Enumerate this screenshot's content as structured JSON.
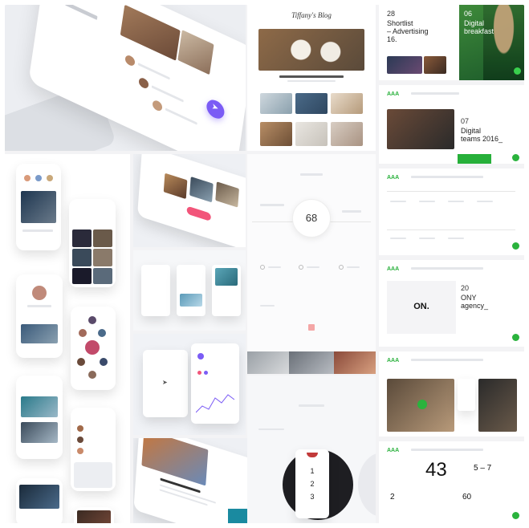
{
  "blog": {
    "title": "Tiffany's Blog"
  },
  "dashboard": {
    "gauge_value": "68"
  },
  "agency": {
    "c1_day": "28",
    "c1_title_l1": "Shortlist",
    "c1_title_l2": "– Advertising",
    "c1_title_l3": "16.",
    "c2_day": "06",
    "c2_title_l1": "Digital",
    "c2_title_l2": "breakfast",
    "c3_day": "07",
    "c3_title_l1": "Digital",
    "c3_title_l2": "teams 2016_",
    "logo_text": "ON.",
    "c4_day": "20",
    "c4_title_l1": "ONY",
    "c4_title_l2": "agency_",
    "stat_big": "43",
    "stat_range": "5 – 7",
    "stat_small_1": "2",
    "stat_small_2": "60"
  },
  "ordered_list": {
    "items": [
      "1",
      "2",
      "3"
    ]
  },
  "colors": {
    "accent_green": "#27b03a",
    "accent_purple": "#7b5cf5",
    "accent_pink": "#f2557a"
  },
  "icons": {
    "fab": "arrow-icon",
    "menu": "menu-icon"
  }
}
